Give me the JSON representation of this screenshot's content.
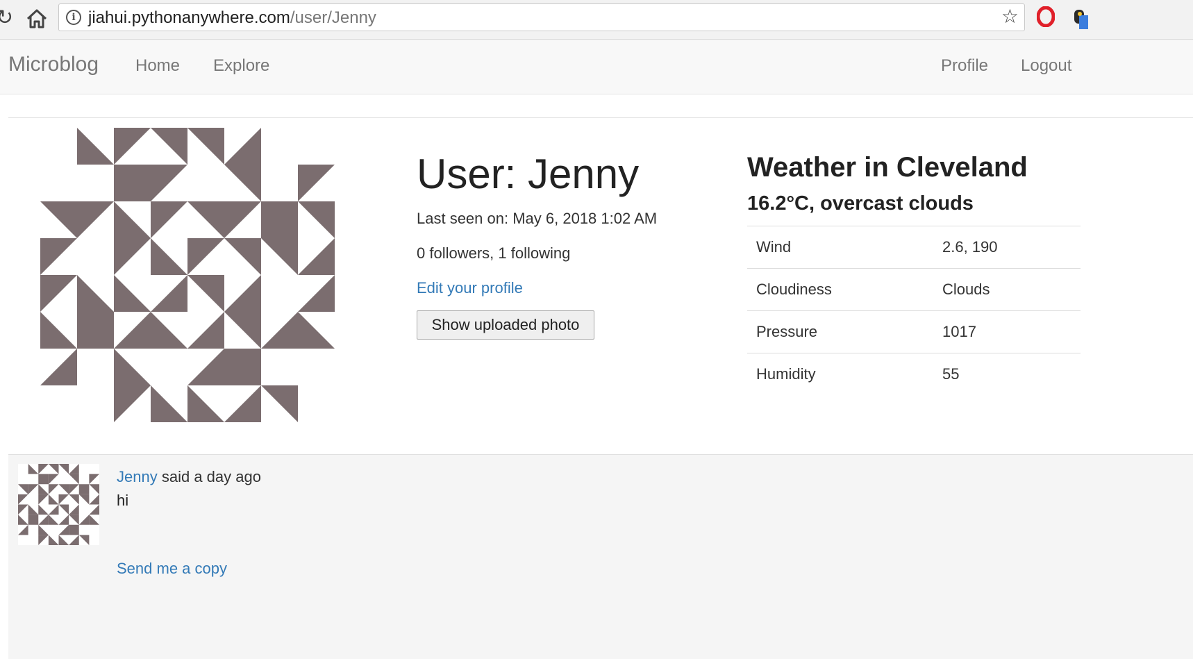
{
  "browser": {
    "url_host": "jiahui.pythonanywhere.com",
    "url_path": "/user/Jenny"
  },
  "navbar": {
    "brand": "Microblog",
    "left_links": [
      "Home",
      "Explore"
    ],
    "right_links": [
      "Profile",
      "Logout"
    ]
  },
  "profile": {
    "title": "User: Jenny",
    "last_seen": "Last seen on: May 6, 2018 1:02 AM",
    "follow_counts": "0 followers, 1 following",
    "edit_link": "Edit your profile",
    "photo_button": "Show uploaded photo"
  },
  "weather": {
    "title": "Weather in Cleveland",
    "summary": "16.2°C, overcast clouds",
    "rows": [
      {
        "label": "Wind",
        "value": "2.6, 190"
      },
      {
        "label": "Cloudiness",
        "value": "Clouds"
      },
      {
        "label": "Pressure",
        "value": "1017"
      },
      {
        "label": "Humidity",
        "value": "55"
      }
    ]
  },
  "post": {
    "author": "Jenny",
    "said": "said a day ago",
    "body": "hi",
    "copy_link": "Send me a copy"
  },
  "colors": {
    "link": "#337ab7",
    "avatar": "#7b6d6f",
    "navbar_bg": "#f8f8f8",
    "post_bg": "#f5f5f5"
  },
  "icons": [
    "reload-icon",
    "home-icon",
    "info-icon",
    "star-icon",
    "opera-extension-icon",
    "extension-icon"
  ]
}
